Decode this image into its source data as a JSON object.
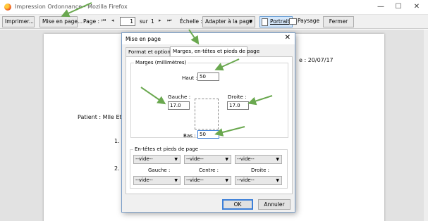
{
  "window": {
    "title": "Impression Ordonnance - Mozilla Firefox",
    "icon": "firefox-icon"
  },
  "toolbar": {
    "print_label": "Imprimer...",
    "page_setup_label": "Mise en page...",
    "page_label": "Page :",
    "first_icon": "⏮",
    "prev_icon": "◂",
    "page_value": "1",
    "of_label": "sur",
    "total_pages": "1",
    "next_icon": "▸",
    "last_icon": "⏭",
    "scale_label": "Échelle :",
    "scale_value": "Adapter à la page",
    "portrait_label": "Portrait",
    "landscape_label": "Paysage",
    "close_label": "Fermer"
  },
  "preview": {
    "date_text": "e : 20/07/17",
    "patient_text": "Patient : Mlle Et",
    "item1": "1.",
    "item2": "2."
  },
  "dialog": {
    "title": "Mise en page",
    "close_icon": "✕",
    "tabs": [
      {
        "label": "Format et options"
      },
      {
        "label": "Marges, en-têtes et pieds de page"
      }
    ],
    "margins": {
      "legend": "Marges (millimètres)",
      "top_label": "Haut :",
      "top_value": "50",
      "left_label": "Gauche :",
      "left_value": "17.0",
      "right_label": "Droite :",
      "right_value": "17.0",
      "bottom_label": "Bas :",
      "bottom_value": "50"
    },
    "headers": {
      "legend": "En-têtes et pieds de page",
      "top_selects": [
        "--vide--",
        "--vide--",
        "--vide--"
      ],
      "left_label": "Gauche :",
      "center_label": "Centre :",
      "right_label": "Droite :",
      "bottom_selects": [
        "--vide--",
        "--vide--",
        "--vide--"
      ]
    },
    "ok_label": "OK",
    "cancel_label": "Annuler"
  },
  "colors": {
    "annotation_arrow": "#6aa84f",
    "focus_border": "#3c7fd8"
  }
}
